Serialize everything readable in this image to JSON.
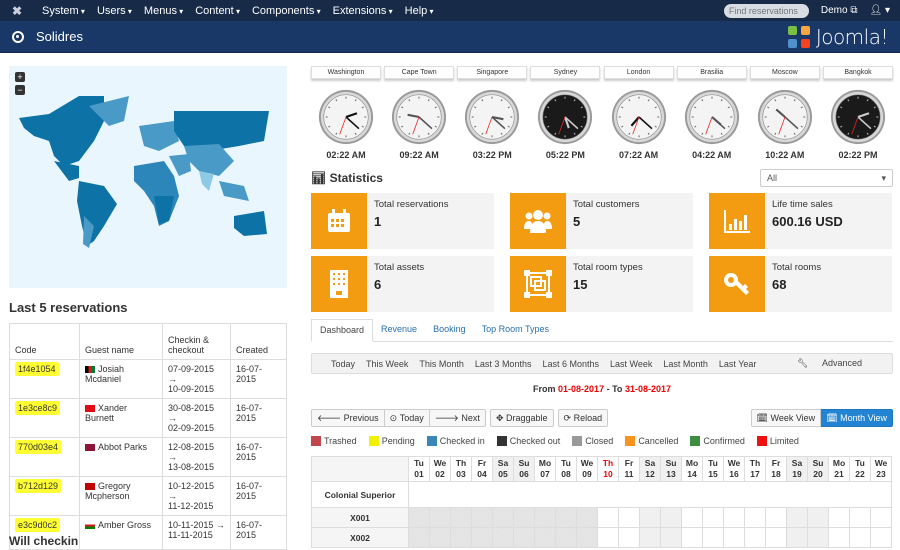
{
  "topnav": {
    "menu": [
      "System",
      "Users",
      "Menus",
      "Content",
      "Components",
      "Extensions",
      "Help"
    ],
    "search_placeholder": "Find reservations",
    "demo_label": "Demo",
    "user_icon": "user-icon"
  },
  "title": {
    "text": "Solidres",
    "brand": "Joomla!"
  },
  "map": {
    "zoom_in": "+",
    "zoom_out": "−"
  },
  "reservations": {
    "heading": "Last 5 reservations",
    "columns": [
      "Code",
      "Guest name",
      "Checkin & checkout",
      "Created"
    ],
    "rows": [
      {
        "code": "1f4e1054",
        "guest": "Josiah Mcdaniel",
        "flag": "afghanistan",
        "checkin": "07-09-2015",
        "checkout": "10-09-2015",
        "created": "16-07-2015"
      },
      {
        "code": "1e3ce8c9",
        "guest": "Xander Burnett",
        "flag": "turkey",
        "checkin": "30-08-2015",
        "checkout": "02-09-2015",
        "created": "16-07-2015"
      },
      {
        "code": "770d03e4",
        "guest": "Abbot Parks",
        "flag": "sri-lanka",
        "checkin": "12-08-2015",
        "checkout": "13-08-2015",
        "created": "16-07-2015"
      },
      {
        "code": "b712d129",
        "guest": "Gregory Mcpherson",
        "flag": "tonga",
        "checkin": "10-12-2015",
        "checkout": "11-12-2015",
        "created": "16-07-2015"
      },
      {
        "code": "e3c9d0c2",
        "guest": "Amber Gross",
        "flag": "oman",
        "checkin": "10-11-2015",
        "checkout": "11-11-2015",
        "created": "16-07-2015"
      }
    ],
    "arrow": "→"
  },
  "will_checkin": "Will checkin",
  "clocks": [
    {
      "city": "Washington",
      "time": "02:22 AM",
      "style": "silver-dark-hands"
    },
    {
      "city": "Cape Town",
      "time": "09:22 AM",
      "style": "chrome"
    },
    {
      "city": "Singapore",
      "time": "03:22 PM",
      "style": "numbered"
    },
    {
      "city": "Sydney",
      "time": "05:22 PM",
      "style": "black"
    },
    {
      "city": "London",
      "time": "07:22 AM",
      "style": "silver-dark-hands"
    },
    {
      "city": "Brasilia",
      "time": "04:22 AM",
      "style": "chrome"
    },
    {
      "city": "Moscow",
      "time": "10:22 AM",
      "style": "numbered"
    },
    {
      "city": "Bangkok",
      "time": "02:22 PM",
      "style": "black"
    }
  ],
  "statistics": {
    "heading": "Statistics",
    "filter": "All",
    "cards": [
      {
        "label": "Total reservations",
        "value": "1",
        "icon": "calendar-icon"
      },
      {
        "label": "Total customers",
        "value": "5",
        "icon": "users-icon"
      },
      {
        "label": "Life time sales",
        "value": "600.16 USD",
        "icon": "bar-chart-icon"
      },
      {
        "label": "Total assets",
        "value": "6",
        "icon": "building-icon"
      },
      {
        "label": "Total room types",
        "value": "15",
        "icon": "object-group-icon"
      },
      {
        "label": "Total rooms",
        "value": "68",
        "icon": "key-icon"
      }
    ]
  },
  "tabs": [
    "Dashboard",
    "Revenue",
    "Booking",
    "Top Room Types"
  ],
  "active_tab": "Dashboard",
  "ranges": [
    "Today",
    "This Week",
    "This Month",
    "Last 3 Months",
    "Last 6 Months",
    "Last Week",
    "Last Month",
    "Last Year"
  ],
  "advanced": "Advanced",
  "period": {
    "from_label": "From",
    "from": "01-08-2017",
    "to_label": "- To",
    "to": "31-08-2017"
  },
  "toolbar": {
    "previous": "Previous",
    "today": "Today",
    "next": "Next",
    "draggable": "Draggable",
    "reload": "Reload",
    "week_view": "Week View",
    "month_view": "Month View"
  },
  "legend": [
    {
      "label": "Trashed",
      "color": "#c0474a"
    },
    {
      "label": "Pending",
      "color": "#f2f200"
    },
    {
      "label": "Checked in",
      "color": "#3a86b6"
    },
    {
      "label": "Checked out",
      "color": "#333333"
    },
    {
      "label": "Closed",
      "color": "#999999"
    },
    {
      "label": "Cancelled",
      "color": "#f7941d"
    },
    {
      "label": "Confirmed",
      "color": "#3e8e41"
    },
    {
      "label": "Limited",
      "color": "#f01010"
    }
  ],
  "calendar": {
    "room_type": "Colonial Superior",
    "rooms": [
      "X001",
      "X002"
    ],
    "days": [
      {
        "d": "Tu",
        "n": "01"
      },
      {
        "d": "We",
        "n": "02"
      },
      {
        "d": "Th",
        "n": "03"
      },
      {
        "d": "Fr",
        "n": "04"
      },
      {
        "d": "Sa",
        "n": "05"
      },
      {
        "d": "Su",
        "n": "06"
      },
      {
        "d": "Mo",
        "n": "07"
      },
      {
        "d": "Tu",
        "n": "08"
      },
      {
        "d": "We",
        "n": "09"
      },
      {
        "d": "Th",
        "n": "10"
      },
      {
        "d": "Fr",
        "n": "11"
      },
      {
        "d": "Sa",
        "n": "12"
      },
      {
        "d": "Su",
        "n": "13"
      },
      {
        "d": "Mo",
        "n": "14"
      },
      {
        "d": "Tu",
        "n": "15"
      },
      {
        "d": "We",
        "n": "16"
      },
      {
        "d": "Th",
        "n": "17"
      },
      {
        "d": "Fr",
        "n": "18"
      },
      {
        "d": "Sa",
        "n": "19"
      },
      {
        "d": "Su",
        "n": "20"
      },
      {
        "d": "Mo",
        "n": "21"
      },
      {
        "d": "Tu",
        "n": "22"
      },
      {
        "d": "We",
        "n": "23"
      }
    ],
    "today_index": 9
  }
}
